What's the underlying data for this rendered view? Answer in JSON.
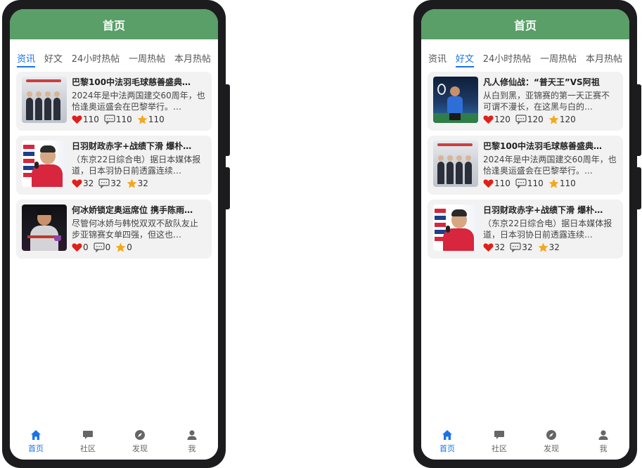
{
  "colors": {
    "header": "#5a9e68",
    "accent": "#1a73e8",
    "heart": "#e0201a",
    "star": "#f4a81d"
  },
  "left": {
    "header_title": "首页",
    "tabs": [
      {
        "label": "资讯",
        "active": true
      },
      {
        "label": "好文",
        "active": false
      },
      {
        "label": "24小时热帖",
        "active": false
      },
      {
        "label": "一周热帖",
        "active": false
      },
      {
        "label": "本月热帖",
        "active": false
      }
    ],
    "cards": [
      {
        "thumb": "gala-photo",
        "title": "巴黎100中法羽毛球慈善盛典…",
        "desc": "2024年是中法两国建交60周年，也恰逢奥运盛会在巴黎举行。…",
        "likes": "110",
        "comments": "110",
        "stars": "110"
      },
      {
        "thumb": "press-conference-photo",
        "title": "日羽财政赤字+战绩下滑 爆朴…",
        "desc": "（东京22日综合电）据日本媒体报道，日本羽协日前透露连续…",
        "likes": "32",
        "comments": "32",
        "stars": "32"
      },
      {
        "thumb": "player-photo",
        "title": "何冰娇锁定奥运席位 携手陈雨…",
        "desc": "尽管何冰娇与韩悦双双不敌队友止步亚锦赛女单四强，但这也…",
        "likes": "0",
        "comments": "0",
        "stars": "0"
      }
    ]
  },
  "right": {
    "header_title": "首页",
    "tabs": [
      {
        "label": "资讯",
        "active": false
      },
      {
        "label": "好文",
        "active": true
      },
      {
        "label": "24小时热帖",
        "active": false
      },
      {
        "label": "一周热帖",
        "active": false
      },
      {
        "label": "本月热帖",
        "active": false
      }
    ],
    "cards": [
      {
        "thumb": "badminton-match-photo",
        "title": "凡人修仙战：“普天王”VS阿祖",
        "desc": "从白到黑，亚锦赛的第一天正赛不可谓不漫长，在这黑与白的…",
        "likes": "120",
        "comments": "120",
        "stars": "120"
      },
      {
        "thumb": "gala-photo",
        "title": "巴黎100中法羽毛球慈善盛典…",
        "desc": "2024年是中法两国建交60周年，也恰逢奥运盛会在巴黎举行。…",
        "likes": "110",
        "comments": "110",
        "stars": "110"
      },
      {
        "thumb": "press-conference-photo",
        "title": "日羽财政赤字+战绩下滑 爆朴…",
        "desc": "（东京22日综合电）据日本媒体报道，日本羽协日前透露连续…",
        "likes": "32",
        "comments": "32",
        "stars": "32"
      }
    ]
  },
  "tabbar": [
    {
      "label": "首页",
      "icon": "home-icon",
      "active": true
    },
    {
      "label": "社区",
      "icon": "chat-icon",
      "active": false
    },
    {
      "label": "发现",
      "icon": "compass-icon",
      "active": false
    },
    {
      "label": "我",
      "icon": "user-icon",
      "active": false
    }
  ]
}
